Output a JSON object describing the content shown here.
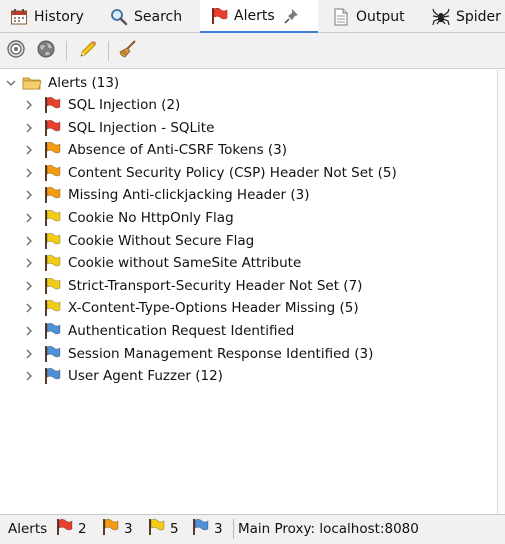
{
  "tabs": [
    {
      "label": "History",
      "icon": "history-calendar-icon"
    },
    {
      "label": "Search",
      "icon": "magnifier-icon"
    },
    {
      "label": "Alerts",
      "icon": "red-flag-icon",
      "active": true
    },
    {
      "label": "Output",
      "icon": "document-icon"
    },
    {
      "label": "Spider",
      "icon": "spider-icon"
    }
  ],
  "toolbar": {
    "buttons": [
      "target-icon",
      "globe-icon",
      "pencil-icon",
      "broom-icon"
    ]
  },
  "tree": {
    "root_label": "Alerts (13)",
    "items": [
      {
        "label": "SQL Injection (2)",
        "risk": "high"
      },
      {
        "label": "SQL Injection - SQLite",
        "risk": "high"
      },
      {
        "label": "Absence of Anti-CSRF Tokens (3)",
        "risk": "medium"
      },
      {
        "label": "Content Security Policy (CSP) Header Not Set (5)",
        "risk": "medium"
      },
      {
        "label": "Missing Anti-clickjacking Header (3)",
        "risk": "medium"
      },
      {
        "label": "Cookie No HttpOnly Flag",
        "risk": "low"
      },
      {
        "label": "Cookie Without Secure Flag",
        "risk": "low"
      },
      {
        "label": "Cookie without SameSite Attribute",
        "risk": "low"
      },
      {
        "label": "Strict-Transport-Security Header Not Set (7)",
        "risk": "low"
      },
      {
        "label": "X-Content-Type-Options Header Missing (5)",
        "risk": "low"
      },
      {
        "label": "Authentication Request Identified",
        "risk": "info"
      },
      {
        "label": "Session Management Response Identified (3)",
        "risk": "info"
      },
      {
        "label": "User Agent Fuzzer (12)",
        "risk": "info"
      }
    ]
  },
  "status": {
    "alerts_label": "Alerts",
    "high_count": "2",
    "medium_count": "3",
    "low_count": "5",
    "info_count": "3",
    "proxy": "Main Proxy: localhost:8080"
  },
  "colors": {
    "high": "#e8402f",
    "medium": "#f39c12",
    "low": "#f2cc15",
    "info": "#4f8fd6",
    "accent": "#3b7dd8"
  }
}
